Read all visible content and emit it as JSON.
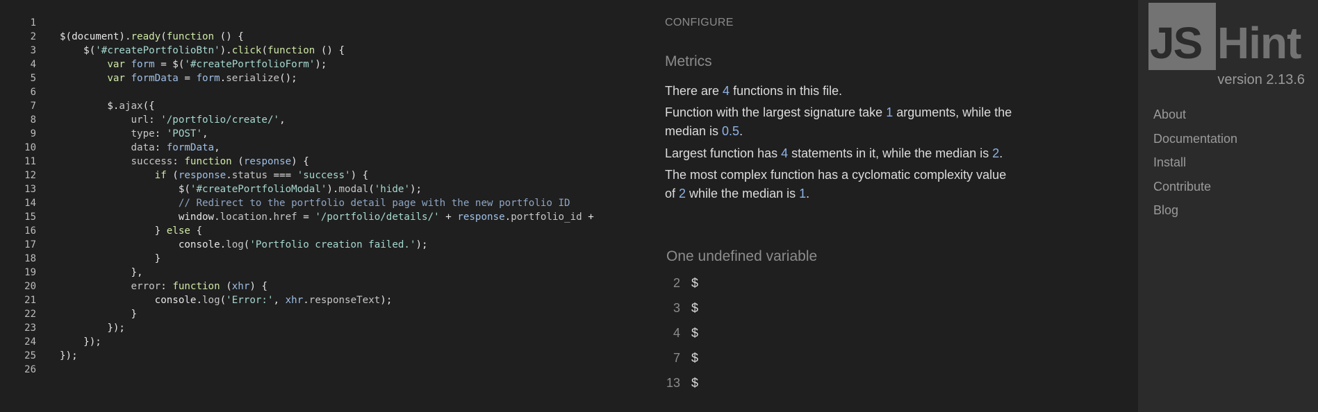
{
  "editor": {
    "line_numbers": [
      "1",
      "2",
      "3",
      "4",
      "5",
      "6",
      "7",
      "8",
      "9",
      "10",
      "11",
      "12",
      "13",
      "14",
      "15",
      "16",
      "17",
      "18",
      "19",
      "20",
      "21",
      "22",
      "23",
      "24",
      "25",
      "26"
    ]
  },
  "report": {
    "configure_label": "CONFIGURE",
    "metrics_title": "Metrics",
    "metrics": {
      "l1a": "There are ",
      "l1n": "4",
      "l1b": " functions in this file.",
      "l2a": "Function with the largest signature take ",
      "l2n": "1",
      "l2b": " arguments, while the",
      "l3a": "median is ",
      "l3n": "0.5",
      "l3b": ".",
      "l4a": "Largest function has ",
      "l4n": "4",
      "l4b": " statements in it, while the median is ",
      "l4n2": "2",
      "l4c": ".",
      "l5": "The most complex function has a cyclomatic complexity value",
      "l6a": "of ",
      "l6n": "2",
      "l6b": " while the median is ",
      "l6n2": "1",
      "l6c": "."
    },
    "undefined_title": "One undefined variable",
    "undefined": [
      {
        "line": "2",
        "name": "$"
      },
      {
        "line": "3",
        "name": "$"
      },
      {
        "line": "4",
        "name": "$"
      },
      {
        "line": "7",
        "name": "$"
      },
      {
        "line": "13",
        "name": "$"
      }
    ]
  },
  "sidebar": {
    "logo_js": "JS",
    "logo_hint": "Hint",
    "version": "version 2.13.6",
    "nav": [
      "About",
      "Documentation",
      "Install",
      "Contribute",
      "Blog"
    ]
  },
  "colors": {
    "background": "#1f1f1f",
    "sidebar": "#2b2b2b",
    "number_accent": "#8fb3e6"
  }
}
